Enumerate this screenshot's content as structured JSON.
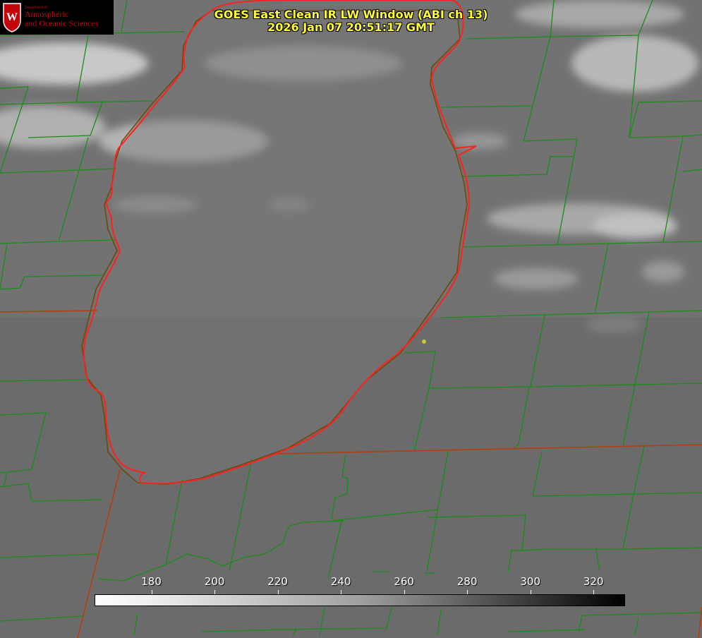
{
  "header": {
    "title_line1": "GOES East Clean IR LW Window (ABI ch 13)",
    "title_line2": "2026 Jan 07 20:51:17 GMT"
  },
  "logo": {
    "dept": "Department of",
    "line1": "Atmospheric",
    "line2": "and Oceanic Sciences",
    "color": "#c5050c"
  },
  "colorbar": {
    "ticks": [
      "180",
      "200",
      "220",
      "240",
      "260",
      "280",
      "300",
      "320"
    ],
    "range": [
      162,
      330
    ]
  },
  "colors": {
    "lake_outline": "#ff2020",
    "county_lines": "#1a8c1a",
    "state_lines": "#b33d10",
    "title": "#ffff33",
    "marker": "#c8c832"
  }
}
